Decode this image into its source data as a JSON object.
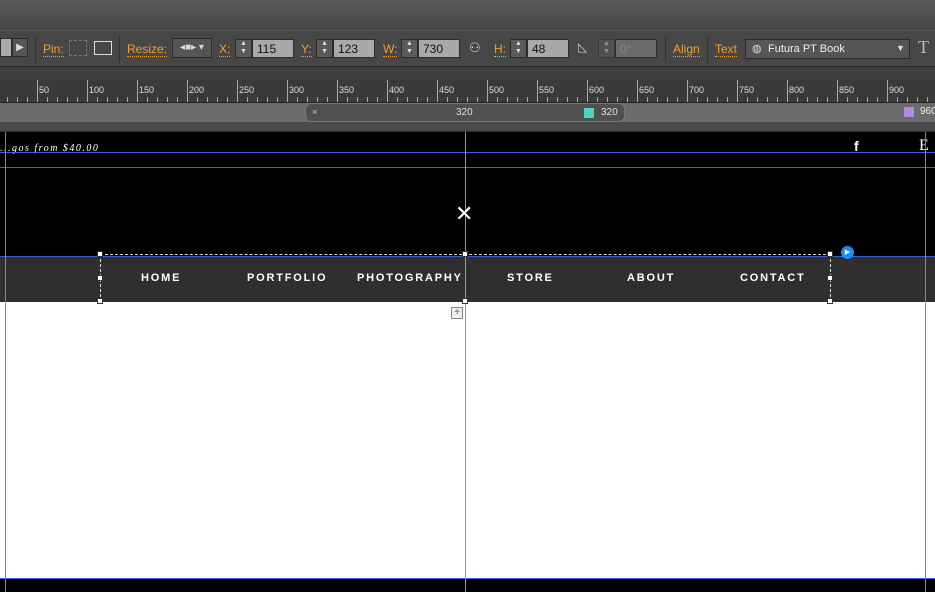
{
  "toolbar": {
    "pin_label": "Pin:",
    "resize_label": "Resize:",
    "x_label": "X:",
    "x_value": "115",
    "y_label": "Y:",
    "y_value": "123",
    "w_label": "W:",
    "w_value": "730",
    "h_label": "H:",
    "h_value": "48",
    "rotation_value": "0°",
    "align_label": "Align",
    "text_label": "Text",
    "font_value": "Futura PT Book"
  },
  "ruler": {
    "labels": [
      "50",
      "100",
      "150",
      "200",
      "250",
      "300",
      "350",
      "400",
      "450",
      "500",
      "550",
      "600",
      "650",
      "700",
      "750",
      "800",
      "850",
      "900"
    ]
  },
  "breakpoints": {
    "close": "×",
    "width_center": "320",
    "width_marker": "320",
    "next_marker": "960",
    "marker_color": "#4fd1c5",
    "next_color": "#b48be0"
  },
  "page": {
    "promo_text": "...gos from $40.00",
    "facebook": "f",
    "e_icon": "E"
  },
  "nav": {
    "items": [
      "HOME",
      "PORTFOLIO",
      "PHOTOGRAPHY",
      "STORE",
      "ABOUT",
      "CONTACT"
    ]
  }
}
